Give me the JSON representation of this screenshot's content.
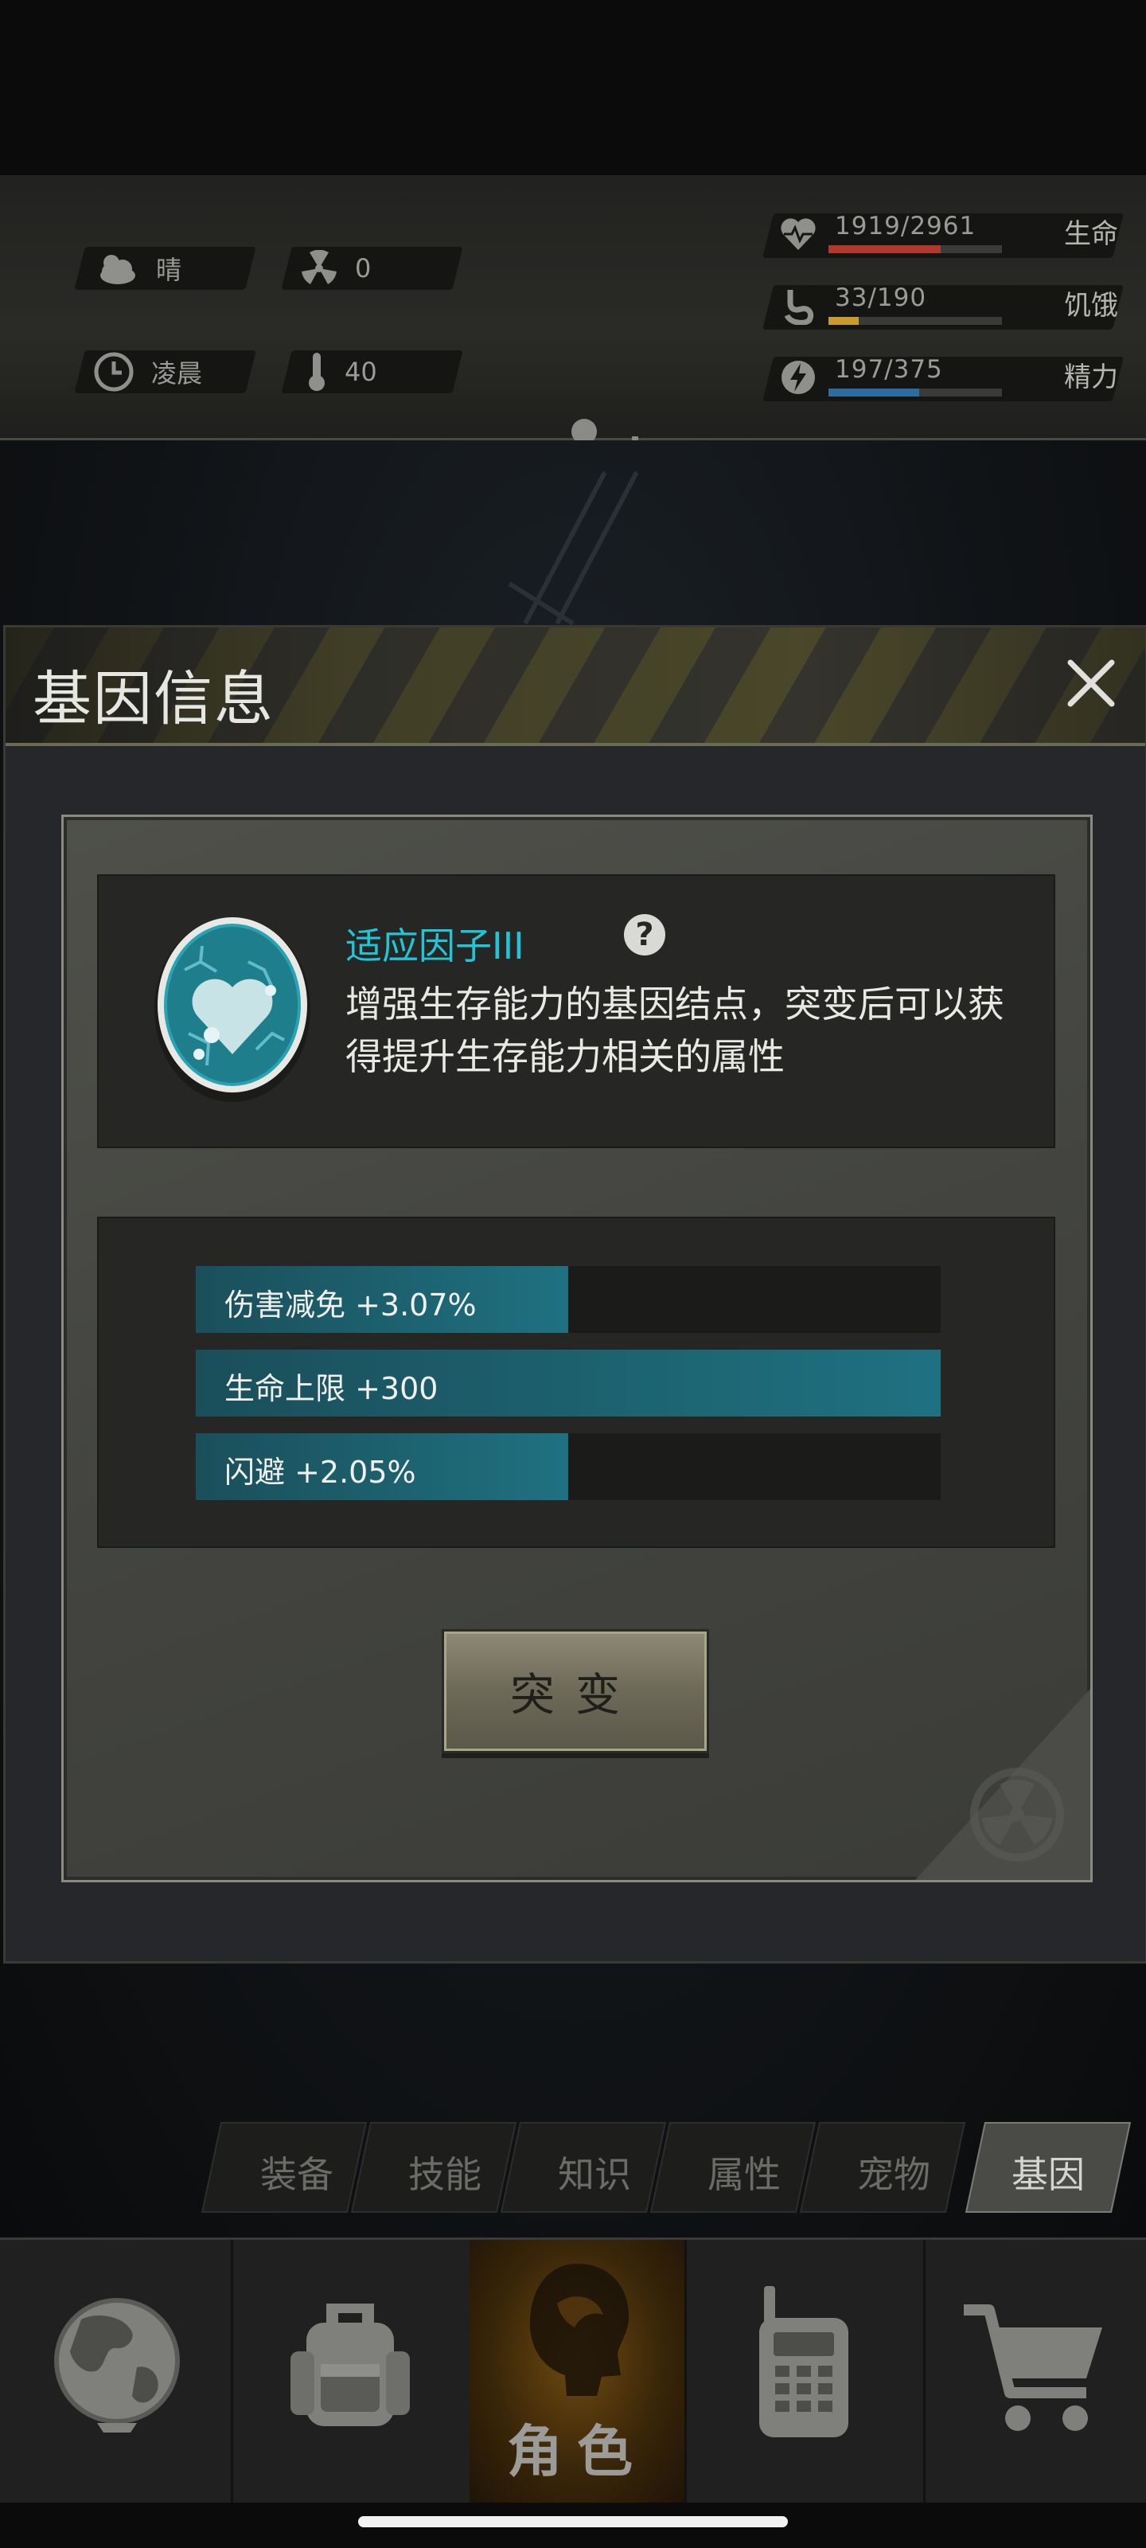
{
  "status": {
    "weather": "晴",
    "radiation": "0",
    "time_of_day": "凌晨",
    "temperature": "40",
    "health": {
      "value": "1919/2961",
      "label": "生命",
      "fraction": 0.648,
      "color": "#b2382b"
    },
    "hunger": {
      "value": "33/190",
      "label": "饥饿",
      "fraction": 0.174,
      "color": "#c99a2c"
    },
    "energy": {
      "value": "197/375",
      "label": "精力",
      "fraction": 0.525,
      "color": "#2a6d9e"
    }
  },
  "modal": {
    "title": "基因信息",
    "gene": {
      "name": "适应因子III",
      "help": "?",
      "description": "增强生存能力的基因结点，突变后可以获得提升生存能力相关的属性"
    },
    "stats": [
      {
        "text": "伤害减免 +3.07%",
        "fraction": 0.5
      },
      {
        "text": "生命上限 +300",
        "fraction": 1.0
      },
      {
        "text": "闪避 +2.05%",
        "fraction": 0.5
      }
    ],
    "mutate_label": "突变"
  },
  "tabs": [
    {
      "label": "装备",
      "active": false
    },
    {
      "label": "技能",
      "active": false
    },
    {
      "label": "知识",
      "active": false
    },
    {
      "label": "属性",
      "active": false
    },
    {
      "label": "宠物",
      "active": false
    },
    {
      "label": "基因",
      "active": true
    }
  ],
  "bottom_nav": {
    "world_icon": "globe-icon",
    "bag_icon": "backpack-icon",
    "character_label": "角色",
    "radio_icon": "walkie-talkie-icon",
    "shop_icon": "cart-icon"
  }
}
